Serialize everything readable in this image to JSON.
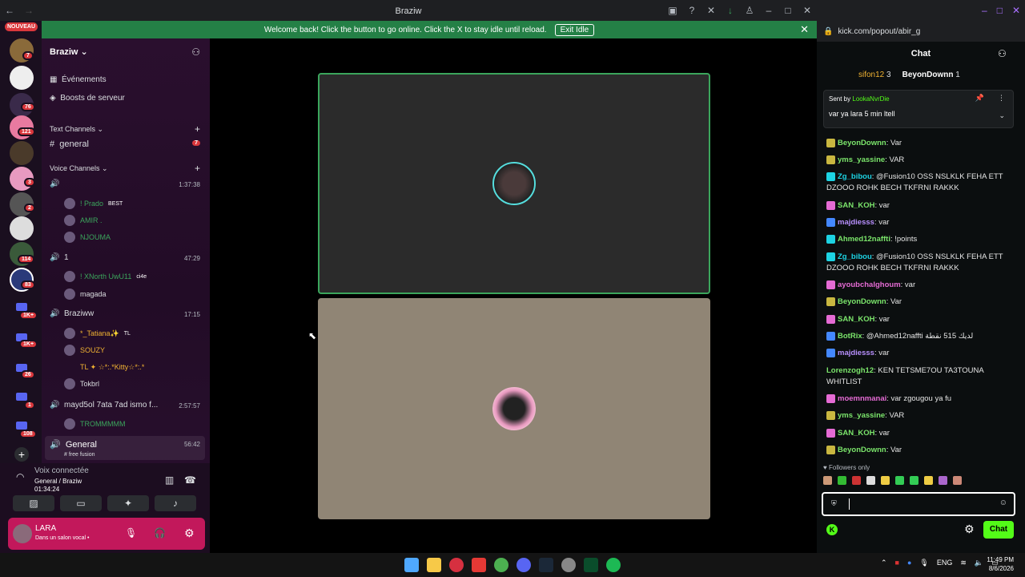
{
  "window": {
    "title": "Braziw"
  },
  "banner": {
    "text": "Welcome back! Click the button to go online. Click the X to stay idle until reload.",
    "button": "Exit Idle"
  },
  "rail": {
    "new_label": "NOUVEAU",
    "badges": [
      "7",
      "76",
      "121",
      "3",
      "2",
      "114",
      "83",
      "1K+",
      "1K+",
      "26",
      "1",
      "108"
    ]
  },
  "server": {
    "name": "Braziw",
    "events": "Événements",
    "boosts": "Boosts de serveur"
  },
  "text_category": "Text Channels",
  "text_channels": [
    {
      "name": "general",
      "badge": "7"
    }
  ],
  "voice_category": "Voice Channels",
  "voice_channels": [
    {
      "name": "",
      "time": "1:37:38",
      "users": [
        "! Prado",
        "AMIR .",
        "NJOUMA"
      ],
      "tag": "BEST"
    },
    {
      "name": "1",
      "time": "47:29",
      "users": [
        "! XNorth UwU11",
        "magada"
      ],
      "tag": "ci4e"
    },
    {
      "name": "Braziww",
      "time": "17:15",
      "users": [
        "*_Tatiana✨",
        "SOUZY",
        "TL ✦ ☆*:.*Kitty☆*:.*",
        "Tokbrl"
      ],
      "tag": "TL"
    },
    {
      "name": "mayd5ol 7ata 7ad ismo f...",
      "time": "2:57:57",
      "users": [
        "TROMMMMM"
      ]
    },
    {
      "name": "General",
      "time": "56:42",
      "users": [
        "# free fusion"
      ]
    }
  ],
  "voice_panel": {
    "status": "Voix connectée",
    "location": "General / Braziw",
    "time": "01:34:24"
  },
  "user": {
    "name": "LARA",
    "status": "Dans un salon vocal •"
  },
  "browser": {
    "url": "kick.com/popout/abir_g"
  },
  "chat": {
    "title": "Chat",
    "top_gifters": [
      {
        "name": "sifon12",
        "count": "3"
      },
      {
        "name": "BeyonDownn",
        "count": "1"
      }
    ],
    "pinned": {
      "sent_by": "Sent by",
      "author": "LookaNvrDie",
      "text": "var ya lara 5 min ltell"
    },
    "messages": [
      {
        "name": "BeyonDownn",
        "text": ": Var",
        "color": "#7be56b"
      },
      {
        "name": "yms_yassine",
        "text": ": VAR",
        "color": "#7be56b"
      },
      {
        "name": "Zg_bibou",
        "text": ": @Fusion10 OSS NSLKLK FEHA ETT DZOOO ROHK BECH TKFRNI RAKKK",
        "color": "#1dd3e3"
      },
      {
        "name": "SAN_KOH",
        "text": ": var",
        "color": "#7be56b"
      },
      {
        "name": "majdiesss",
        "text": ": var",
        "color": "#b78ffd"
      },
      {
        "name": "Ahmed12naffti",
        "text": ": !points",
        "color": "#7be56b"
      },
      {
        "name": "Zg_bibou",
        "text": ": @Fusion10 OSS NSLKLK FEHA ETT DZOOO ROHK BECH TKFRNI RAKKK",
        "color": "#1dd3e3"
      },
      {
        "name": "ayoubchalghoum",
        "text": ": var",
        "color": "#e56bd4"
      },
      {
        "name": "BeyonDownn",
        "text": ": Var",
        "color": "#7be56b"
      },
      {
        "name": "SAN_KOH",
        "text": ": var",
        "color": "#7be56b"
      },
      {
        "name": "BotRix",
        "text": ": @Ahmed12naffti لديك 515 نقطة",
        "color": "#7be56b"
      },
      {
        "name": "majdiesss",
        "text": ": var",
        "color": "#b78ffd"
      },
      {
        "name": "Lorenzogh12",
        "text": ": KEN TETSME7OU TA3TOUNA WHITLIST",
        "color": "#7be56b"
      },
      {
        "name": "moemnmanai",
        "text": ": var zgougou ya fu",
        "color": "#e56bd4"
      },
      {
        "name": "yms_yassine",
        "text": ": VAR",
        "color": "#7be56b"
      },
      {
        "name": "SAN_KOH",
        "text": ": var",
        "color": "#7be56b"
      },
      {
        "name": "BeyonDownn",
        "text": ": Var",
        "color": "#7be56b"
      }
    ],
    "followers_only": "Followers only",
    "send_button": "Chat"
  },
  "taskbar": {
    "lang": "ENG",
    "time": "11:49 PM",
    "date": "8/6/2026"
  }
}
